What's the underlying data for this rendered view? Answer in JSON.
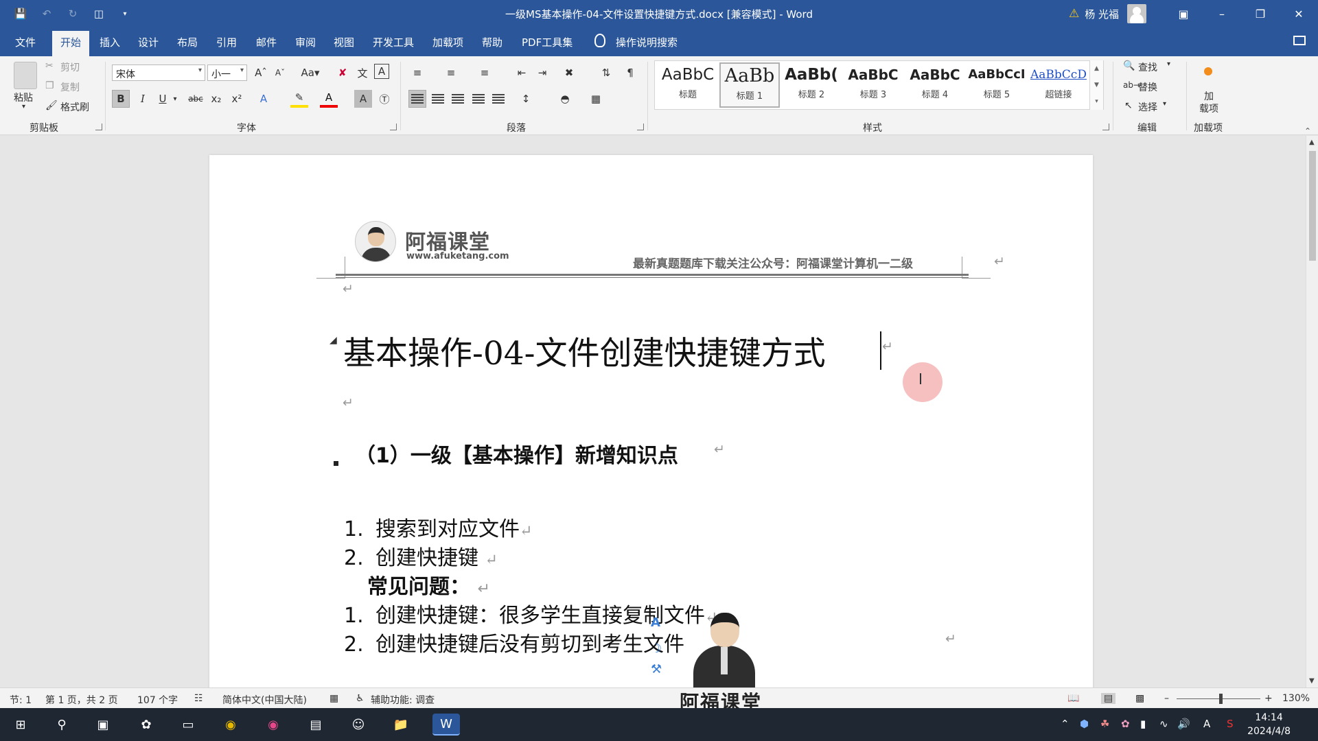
{
  "window": {
    "title": "一级MS基本操作-04-文件设置快捷键方式.docx [兼容模式] - Word",
    "user_name": "杨 光福"
  },
  "tabs": [
    "文件",
    "开始",
    "插入",
    "设计",
    "布局",
    "引用",
    "邮件",
    "审阅",
    "视图",
    "开发工具",
    "加载项",
    "帮助",
    "PDF工具集"
  ],
  "active_tab": "开始",
  "tell_me": "操作说明搜索",
  "ribbon": {
    "clipboard": {
      "label": "剪贴板",
      "paste": "粘贴",
      "cut": "剪切",
      "copy": "复制",
      "format_painter": "格式刷"
    },
    "font": {
      "label": "字体",
      "font_name": "宋体",
      "font_size": "小一",
      "change_case": "Aa"
    },
    "paragraph": {
      "label": "段落"
    },
    "styles": {
      "label": "样式",
      "items": [
        {
          "sample": "AaBbC",
          "name": "标题"
        },
        {
          "sample": "AaBb",
          "name": "标题 1"
        },
        {
          "sample": "AaBb(",
          "name": "标题 2"
        },
        {
          "sample": "AaBbC",
          "name": "标题 3"
        },
        {
          "sample": "AaBbC",
          "name": "标题 4"
        },
        {
          "sample": "AaBbCcI",
          "name": "标题 5"
        },
        {
          "sample": "AaBbCcD",
          "name": "超链接"
        }
      ],
      "selected_index": 1
    },
    "editing": {
      "label": "编辑",
      "find": "查找",
      "replace": "替换",
      "select": "选择"
    },
    "addins": {
      "label": "加载项",
      "button": "加\n载项",
      "btn_line1": "加",
      "btn_line2": "载项"
    }
  },
  "document": {
    "header": {
      "logo_name": "阿福课堂",
      "logo_url": "www.afuketang.com",
      "note": "最新真题题库下载关注公众号：阿福课堂计算机一二级"
    },
    "title": "基本操作-04-文件创建快捷键方式",
    "heading": "（1）一级【基本操作】新增知识点",
    "list": [
      {
        "num": "1.",
        "text": "搜索到对应文件"
      },
      {
        "num": "2.",
        "text": "创建快捷键"
      },
      {
        "num": "",
        "text": "常见问题："
      },
      {
        "num": "1.",
        "text": "创建快捷键：很多学生直接复制文件"
      },
      {
        "num": "2.",
        "text": "创建快捷键后没有剪切到考生文件"
      }
    ],
    "paragraph_mark": "↵",
    "watermark": "阿福课堂"
  },
  "status_bar": {
    "section": "节: 1",
    "page": "第 1 页，共 2 页",
    "words": "107 个字",
    "language": "简体中文(中国大陆)",
    "accessibility": "辅助功能: 调查",
    "zoom": "130%",
    "zoom_level_percent": 130
  },
  "taskbar": {
    "time": "14:14",
    "date": "2024/4/8"
  },
  "colors": {
    "word_blue": "#2b579a",
    "ribbon_bg": "#f3f3f3",
    "taskbar_bg": "#1f2733"
  }
}
